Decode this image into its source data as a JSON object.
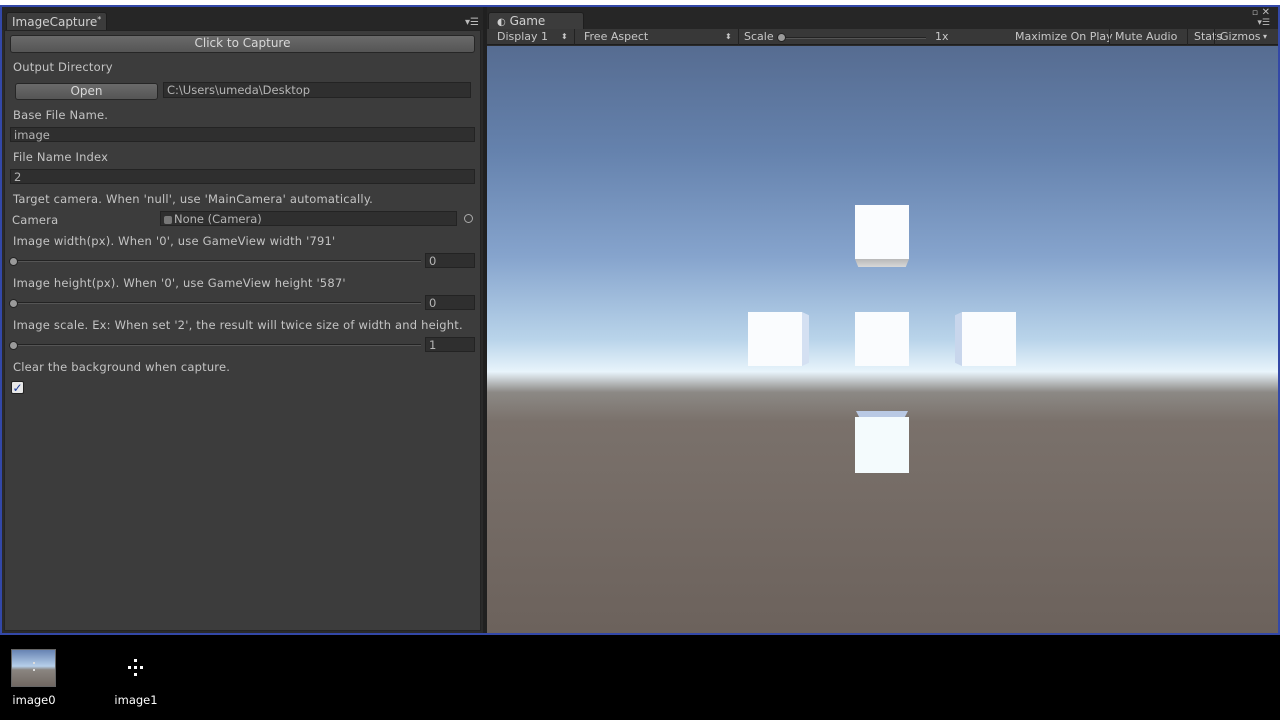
{
  "left_window": {
    "tab_title": "ImageCapture",
    "capture_button": "Click to Capture",
    "output_directory_label": "Output Directory",
    "open_button": "Open",
    "output_directory_value": "C:\\Users\\umeda\\Desktop",
    "base_file_name_label": "Base File Name.",
    "base_file_name_value": "image",
    "file_name_index_label": "File Name Index",
    "file_name_index_value": "2",
    "target_camera_label": "Target camera. When 'null', use 'MainCamera' automatically.",
    "camera_label": "Camera",
    "camera_value": "None (Camera)",
    "width_label": "Image width(px). When '0', use GameView width '791'",
    "width_value": "0",
    "height_label": "Image height(px). When '0', use GameView height '587'",
    "height_value": "0",
    "scale_label": "Image scale. Ex: When set '2', the result will twice size of width and height.",
    "scale_value": "1",
    "clear_bg_label": "Clear the background when capture.",
    "clear_bg_checked": true,
    "checkmark": "✓"
  },
  "game_window": {
    "tab_title": "Game",
    "display": "Display 1",
    "aspect": "Free Aspect",
    "scale_label": "Scale",
    "scale_value": "1x",
    "scale_level": 0,
    "maximize_on_play": "Maximize On Play",
    "mute_audio": "Mute Audio",
    "stats": "Stats",
    "gizmos": "Gizmos"
  },
  "desktop": {
    "icons": [
      {
        "label": "image0"
      },
      {
        "label": "image1"
      }
    ]
  },
  "icons": {
    "menu": "panel-menu-icon",
    "game_tab": "pacman-game-icon",
    "object_picker": "object-picker-icon"
  }
}
